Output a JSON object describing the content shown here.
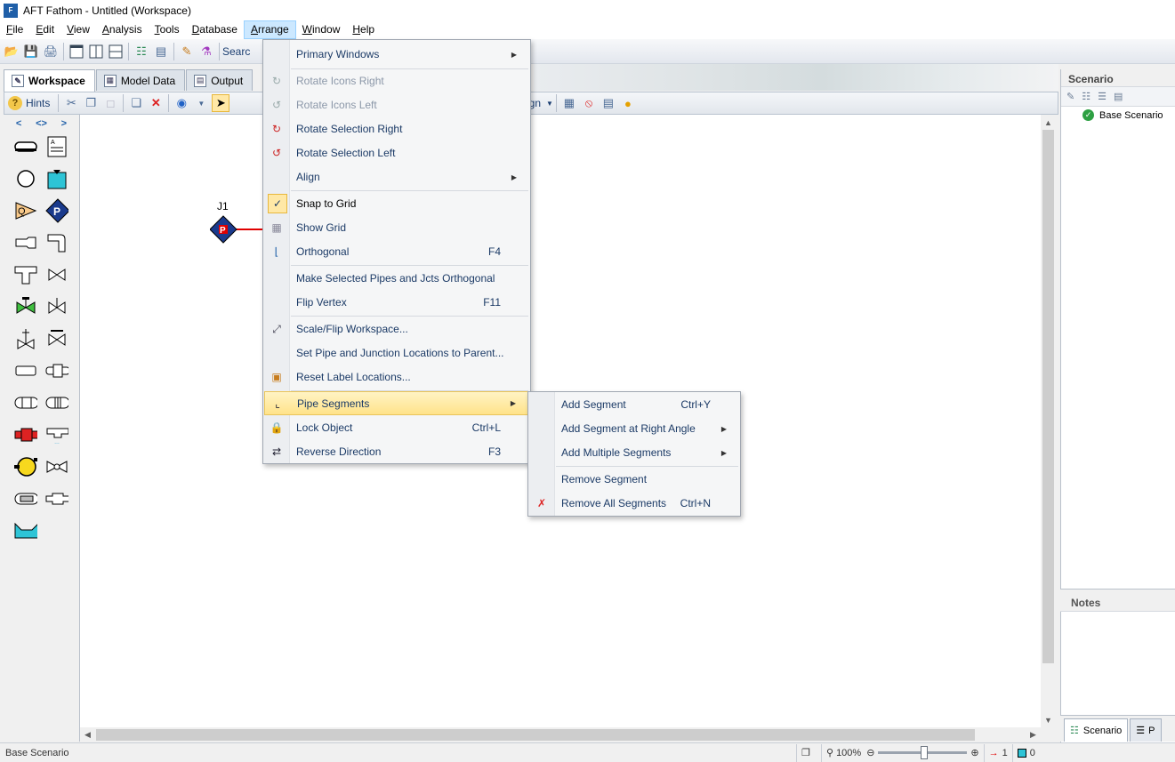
{
  "window": {
    "title": "AFT Fathom - Untitled (Workspace)",
    "app_icon_text": "F"
  },
  "menubar": {
    "items": [
      {
        "label": "File",
        "u": "F",
        "rest": "ile"
      },
      {
        "label": "Edit",
        "u": "E",
        "rest": "dit"
      },
      {
        "label": "View",
        "u": "V",
        "rest": "iew"
      },
      {
        "label": "Analysis",
        "u": "A",
        "rest": "nalysis"
      },
      {
        "label": "Tools",
        "u": "T",
        "rest": "ools"
      },
      {
        "label": "Database",
        "u": "D",
        "rest": "atabase"
      },
      {
        "label": "Arrange",
        "u": "A",
        "rest": "rrange"
      },
      {
        "label": "Window",
        "u": "W",
        "rest": "indow"
      },
      {
        "label": "Help",
        "u": "H",
        "rest": "elp"
      }
    ]
  },
  "toolbar1": {
    "search_label": "Searc"
  },
  "tabs": [
    {
      "label": "Workspace",
      "icon": "pencil-icon"
    },
    {
      "label": "Model Data",
      "icon": "model-data-icon"
    },
    {
      "label": "Output",
      "icon": "output-icon"
    }
  ],
  "toolbar2": {
    "hints_label": "Hints",
    "align_label": "Align"
  },
  "palette": {
    "nav": [
      "<",
      "<>",
      ">"
    ]
  },
  "canvas": {
    "junction_label": "J1",
    "junction_symbol": "P"
  },
  "arrange_menu": {
    "primary_windows": "Primary Windows",
    "rotate_icons_right": "Rotate Icons Right",
    "rotate_icons_left": "Rotate Icons Left",
    "rotate_selection_right": "Rotate Selection Right",
    "rotate_selection_left": "Rotate Selection Left",
    "align": "Align",
    "snap_to_grid": "Snap to Grid",
    "show_grid": "Show Grid",
    "orthogonal": "Orthogonal",
    "orthogonal_key": "F4",
    "make_orthogonal": "Make Selected Pipes and Jcts Orthogonal",
    "flip_vertex": "Flip Vertex",
    "flip_vertex_key": "F11",
    "scale_flip": "Scale/Flip Workspace...",
    "set_locations": "Set Pipe and Junction Locations to Parent...",
    "reset_labels": "Reset Label Locations...",
    "pipe_segments": "Pipe Segments",
    "lock_object": "Lock Object",
    "lock_object_key": "Ctrl+L",
    "reverse_direction": "Reverse Direction",
    "reverse_direction_key": "F3"
  },
  "segments_menu": {
    "add_segment": "Add Segment",
    "add_segment_key": "Ctrl+Y",
    "add_right_angle": "Add Segment at Right Angle",
    "add_multiple": "Add Multiple Segments",
    "remove_segment": "Remove Segment",
    "remove_all": "Remove All Segments",
    "remove_all_key": "Ctrl+N"
  },
  "right_panel": {
    "scenario_header": "Scenario",
    "base_scenario": "Base Scenario",
    "notes_header": "Notes",
    "tab_scenario": "Scenario",
    "tab_other": "P"
  },
  "statusbar": {
    "scenario": "Base Scenario",
    "zoom": "100%",
    "pipe_count": "1",
    "junction_count": "0"
  }
}
